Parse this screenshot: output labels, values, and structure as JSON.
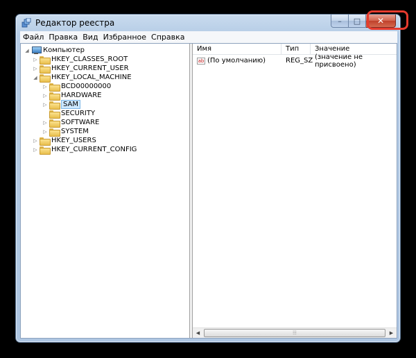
{
  "window": {
    "title": "Редактор реестра",
    "close_glyph": "✕",
    "min_glyph": "–",
    "max_glyph": "□"
  },
  "menu": [
    "Файл",
    "Правка",
    "Вид",
    "Избранное",
    "Справка"
  ],
  "tree": {
    "root": "Компьютер",
    "hives": {
      "classes_root": "HKEY_CLASSES_ROOT",
      "current_user": "HKEY_CURRENT_USER",
      "local_machine": "HKEY_LOCAL_MACHINE",
      "users": "HKEY_USERS",
      "current_config": "HKEY_CURRENT_CONFIG"
    },
    "local_machine_children": [
      "BCD00000000",
      "HARDWARE",
      "SAM",
      "SECURITY",
      "SOFTWARE",
      "SYSTEM"
    ],
    "selected": "SAM"
  },
  "list": {
    "columns": {
      "name": "Имя",
      "type": "Тип",
      "value": "Значение"
    },
    "rows": [
      {
        "name": "(По умолчанию)",
        "type": "REG_SZ",
        "value": "(значение не присвоено)",
        "icon": "ab-string-icon"
      }
    ],
    "ab_icon_text": "ab"
  },
  "toggles": {
    "expanded": "◢",
    "collapsed": "▷"
  },
  "scrollbar": {
    "left_arrow": "◀",
    "right_arrow": "▶",
    "grip": "⦙⦙⦙"
  },
  "colors": {
    "close_button": "#c0402a",
    "highlight": "#e63b2e",
    "selection": "#cde8ff",
    "folder": "#e9bf4e"
  }
}
